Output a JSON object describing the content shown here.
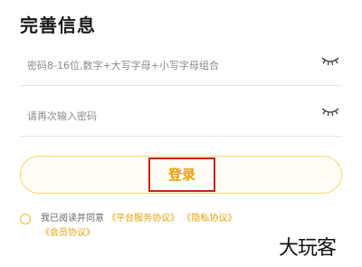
{
  "page": {
    "title": "完善信息"
  },
  "form": {
    "password": {
      "placeholder": "密码8-16位,数字+大写字母+小写字母组合",
      "value": ""
    },
    "confirm_password": {
      "placeholder": "请再次输入密码",
      "value": ""
    },
    "toggle_icon": "eye-closed-icon"
  },
  "login": {
    "label": "登录"
  },
  "agreement": {
    "prefix": "我已阅读并同意",
    "platform_link": "《平台服务协议》",
    "privacy_link": "《隐私协议》",
    "member_link": "《会员协议》"
  },
  "watermark": {
    "text": "大玩客"
  },
  "colors": {
    "accent": "#e9a200",
    "button_border": "#f7d76a",
    "highlight_box": "#c8201e"
  }
}
